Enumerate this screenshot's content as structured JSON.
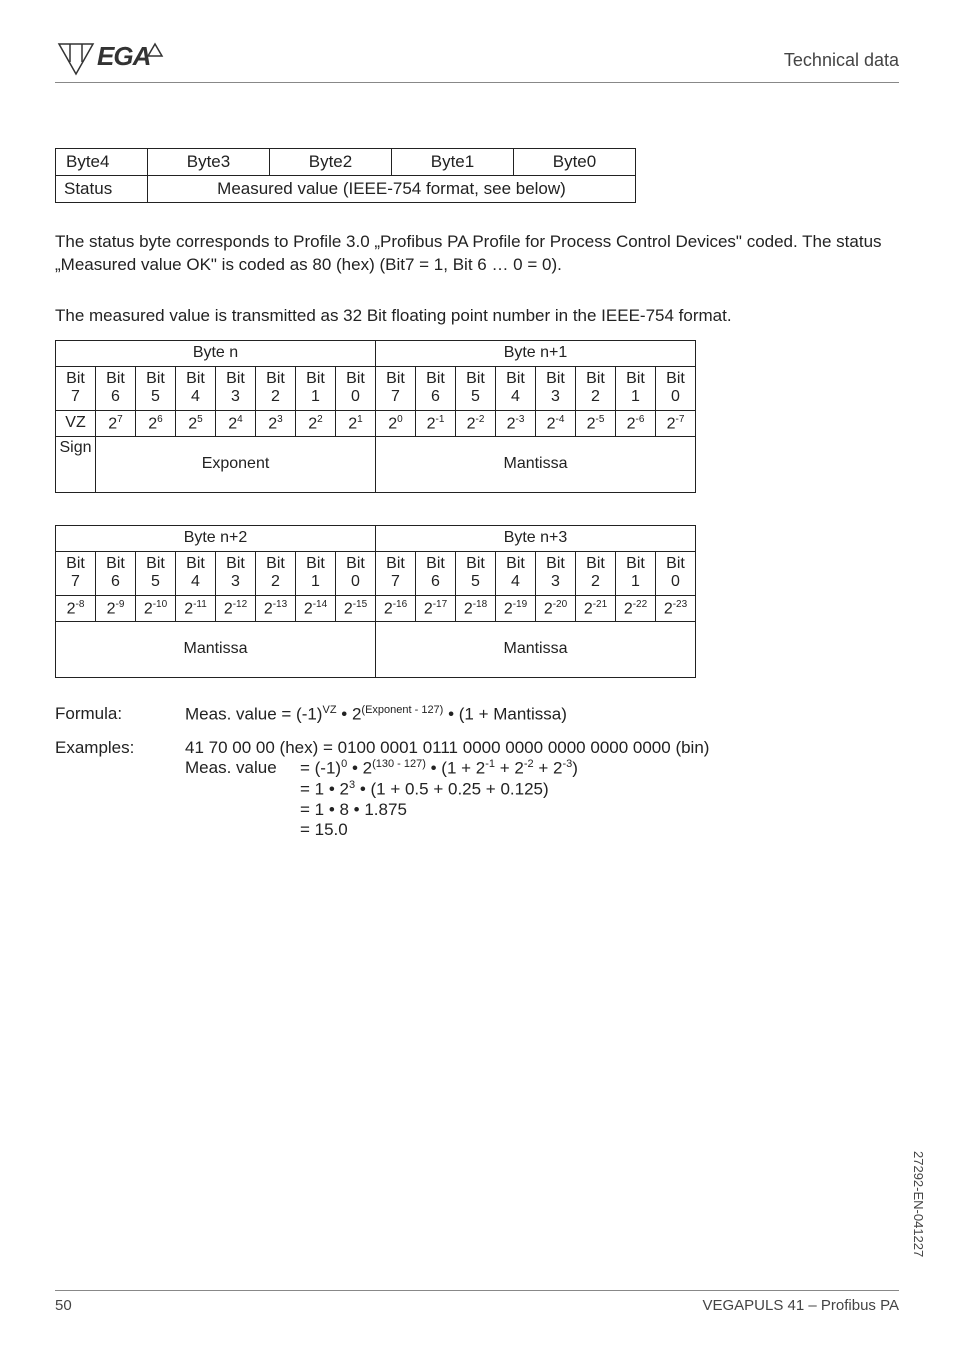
{
  "header": {
    "section_title": "Technical data"
  },
  "byte_layout": {
    "headers": [
      "Byte4",
      "Byte3",
      "Byte2",
      "Byte1",
      "Byte0"
    ],
    "row2_col0": "Status",
    "row2_span": "Measured value (IEEE-754 format, see below)"
  },
  "paragraphs": {
    "p1": "The status byte corresponds to Profile 3.0 „Profibus PA Profile for Process Control Devices\" coded. The status „Measured value OK\" is coded as 80 (hex) (Bit7 = 1, Bit 6 … 0 = 0).",
    "p2": "The measured value is transmitted as 32 Bit floating point number in the IEEE-754 format."
  },
  "bit_tables": [
    {
      "byte_headers": [
        "Byte n",
        "Byte n+1"
      ],
      "bits": [
        "Bit 7",
        "Bit 6",
        "Bit 5",
        "Bit 4",
        "Bit 3",
        "Bit 2",
        "Bit 1",
        "Bit 0",
        "Bit 7",
        "Bit 6",
        "Bit 5",
        "Bit 4",
        "Bit 3",
        "Bit 2",
        "Bit 1",
        "Bit 0"
      ],
      "powers_raw": [
        "VZ",
        "2^7",
        "2^6",
        "2^5",
        "2^4",
        "2^3",
        "2^2",
        "2^1",
        "2^0",
        "2^-1",
        "2^-2",
        "2^-3",
        "2^-4",
        "2^-5",
        "2^-6",
        "2^-7"
      ],
      "labels": [
        {
          "text": "Sign",
          "span": 1
        },
        {
          "text": "Exponent",
          "span": 7
        },
        {
          "text": "Mantissa",
          "span": 8
        }
      ]
    },
    {
      "byte_headers": [
        "Byte n+2",
        "Byte n+3"
      ],
      "bits": [
        "Bit 7",
        "Bit 6",
        "Bit 5",
        "Bit 4",
        "Bit 3",
        "Bit 2",
        "Bit 1",
        "Bit 0",
        "Bit 7",
        "Bit 6",
        "Bit 5",
        "Bit 4",
        "Bit 3",
        "Bit 2",
        "Bit 1",
        "Bit 0"
      ],
      "powers_raw": [
        "2^-8",
        "2^-9",
        "2^-10",
        "2^-11",
        "2^-12",
        "2^-13",
        "2^-14",
        "2^-15",
        "2^-16",
        "2^-17",
        "2^-18",
        "2^-19",
        "2^-20",
        "2^-21",
        "2^-22",
        "2^-23"
      ],
      "labels": [
        {
          "text": "Mantissa",
          "span": 8
        },
        {
          "text": "Mantissa",
          "span": 8
        }
      ]
    }
  ],
  "formula": {
    "label": "Formula:",
    "text_plain": "Meas. value = (-1)^VZ • 2^(Exponent - 127) • (1 + Mantissa)"
  },
  "examples": {
    "label": "Examples:",
    "line1": "41 70 00 00 (hex) = 0100 0001 0111 0000 0000 0000 0000 0000 (bin)",
    "line2_label": "Meas. value",
    "line2_eq_plain": "= (-1)^0 • 2^(130 - 127) • (1 + 2^-1 + 2^-2 + 2^-3)",
    "line3_plain": "= 1 • 2^3 • (1 + 0.5 + 0.25 + 0.125)",
    "line4": "= 1 • 8 • 1.875",
    "line5": "= 15.0"
  },
  "side_code": "27292-EN-041227",
  "footer": {
    "page": "50",
    "doc": "VEGAPULS 41 – Profibus PA"
  }
}
